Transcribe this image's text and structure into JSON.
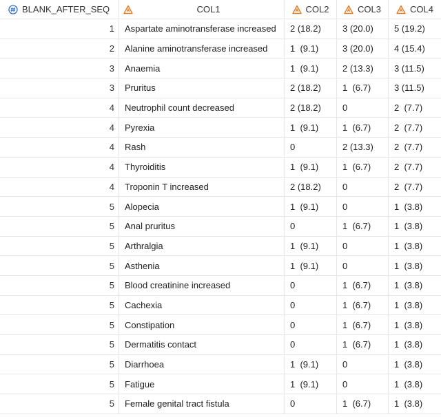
{
  "columns": [
    {
      "name": "BLANK_AFTER_SEQ",
      "type_icon": "numeric-icon"
    },
    {
      "name": "COL1",
      "type_icon": "character-icon"
    },
    {
      "name": "COL2",
      "type_icon": "character-icon"
    },
    {
      "name": "COL3",
      "type_icon": "character-icon"
    },
    {
      "name": "COL4",
      "type_icon": "character-icon"
    }
  ],
  "rows": [
    [
      "1",
      "Aspartate aminotransferase increased",
      "2 (18.2)",
      "3 (20.0)",
      "5 (19.2)"
    ],
    [
      "2",
      "Alanine aminotransferase increased",
      "1  (9.1)",
      "3 (20.0)",
      "4 (15.4)"
    ],
    [
      "3",
      "Anaemia",
      "1  (9.1)",
      "2 (13.3)",
      "3 (11.5)"
    ],
    [
      "3",
      "Pruritus",
      "2 (18.2)",
      "1  (6.7)",
      "3 (11.5)"
    ],
    [
      "4",
      "Neutrophil count decreased",
      "2 (18.2)",
      "0",
      "2  (7.7)"
    ],
    [
      "4",
      "Pyrexia",
      "1  (9.1)",
      "1  (6.7)",
      "2  (7.7)"
    ],
    [
      "4",
      "Rash",
      "0",
      "2 (13.3)",
      "2  (7.7)"
    ],
    [
      "4",
      "Thyroiditis",
      "1  (9.1)",
      "1  (6.7)",
      "2  (7.7)"
    ],
    [
      "4",
      "Troponin T increased",
      "2 (18.2)",
      "0",
      "2  (7.7)"
    ],
    [
      "5",
      "Alopecia",
      "1  (9.1)",
      "0",
      "1  (3.8)"
    ],
    [
      "5",
      "Anal pruritus",
      "0",
      "1  (6.7)",
      "1  (3.8)"
    ],
    [
      "5",
      "Arthralgia",
      "1  (9.1)",
      "0",
      "1  (3.8)"
    ],
    [
      "5",
      "Asthenia",
      "1  (9.1)",
      "0",
      "1  (3.8)"
    ],
    [
      "5",
      "Blood creatinine increased",
      "0",
      "1  (6.7)",
      "1  (3.8)"
    ],
    [
      "5",
      "Cachexia",
      "0",
      "1  (6.7)",
      "1  (3.8)"
    ],
    [
      "5",
      "Constipation",
      "0",
      "1  (6.7)",
      "1  (3.8)"
    ],
    [
      "5",
      "Dermatitis contact",
      "0",
      "1  (6.7)",
      "1  (3.8)"
    ],
    [
      "5",
      "Diarrhoea",
      "1  (9.1)",
      "0",
      "1  (3.8)"
    ],
    [
      "5",
      "Fatigue",
      "1  (9.1)",
      "0",
      "1  (3.8)"
    ],
    [
      "5",
      "Female genital tract fistula",
      "0",
      "1  (6.7)",
      "1  (3.8)"
    ]
  ],
  "colors": {
    "numeric_icon": "#2a6cc7",
    "character_icon": "#e07b1e",
    "grid_line": "#e6e6e6"
  }
}
